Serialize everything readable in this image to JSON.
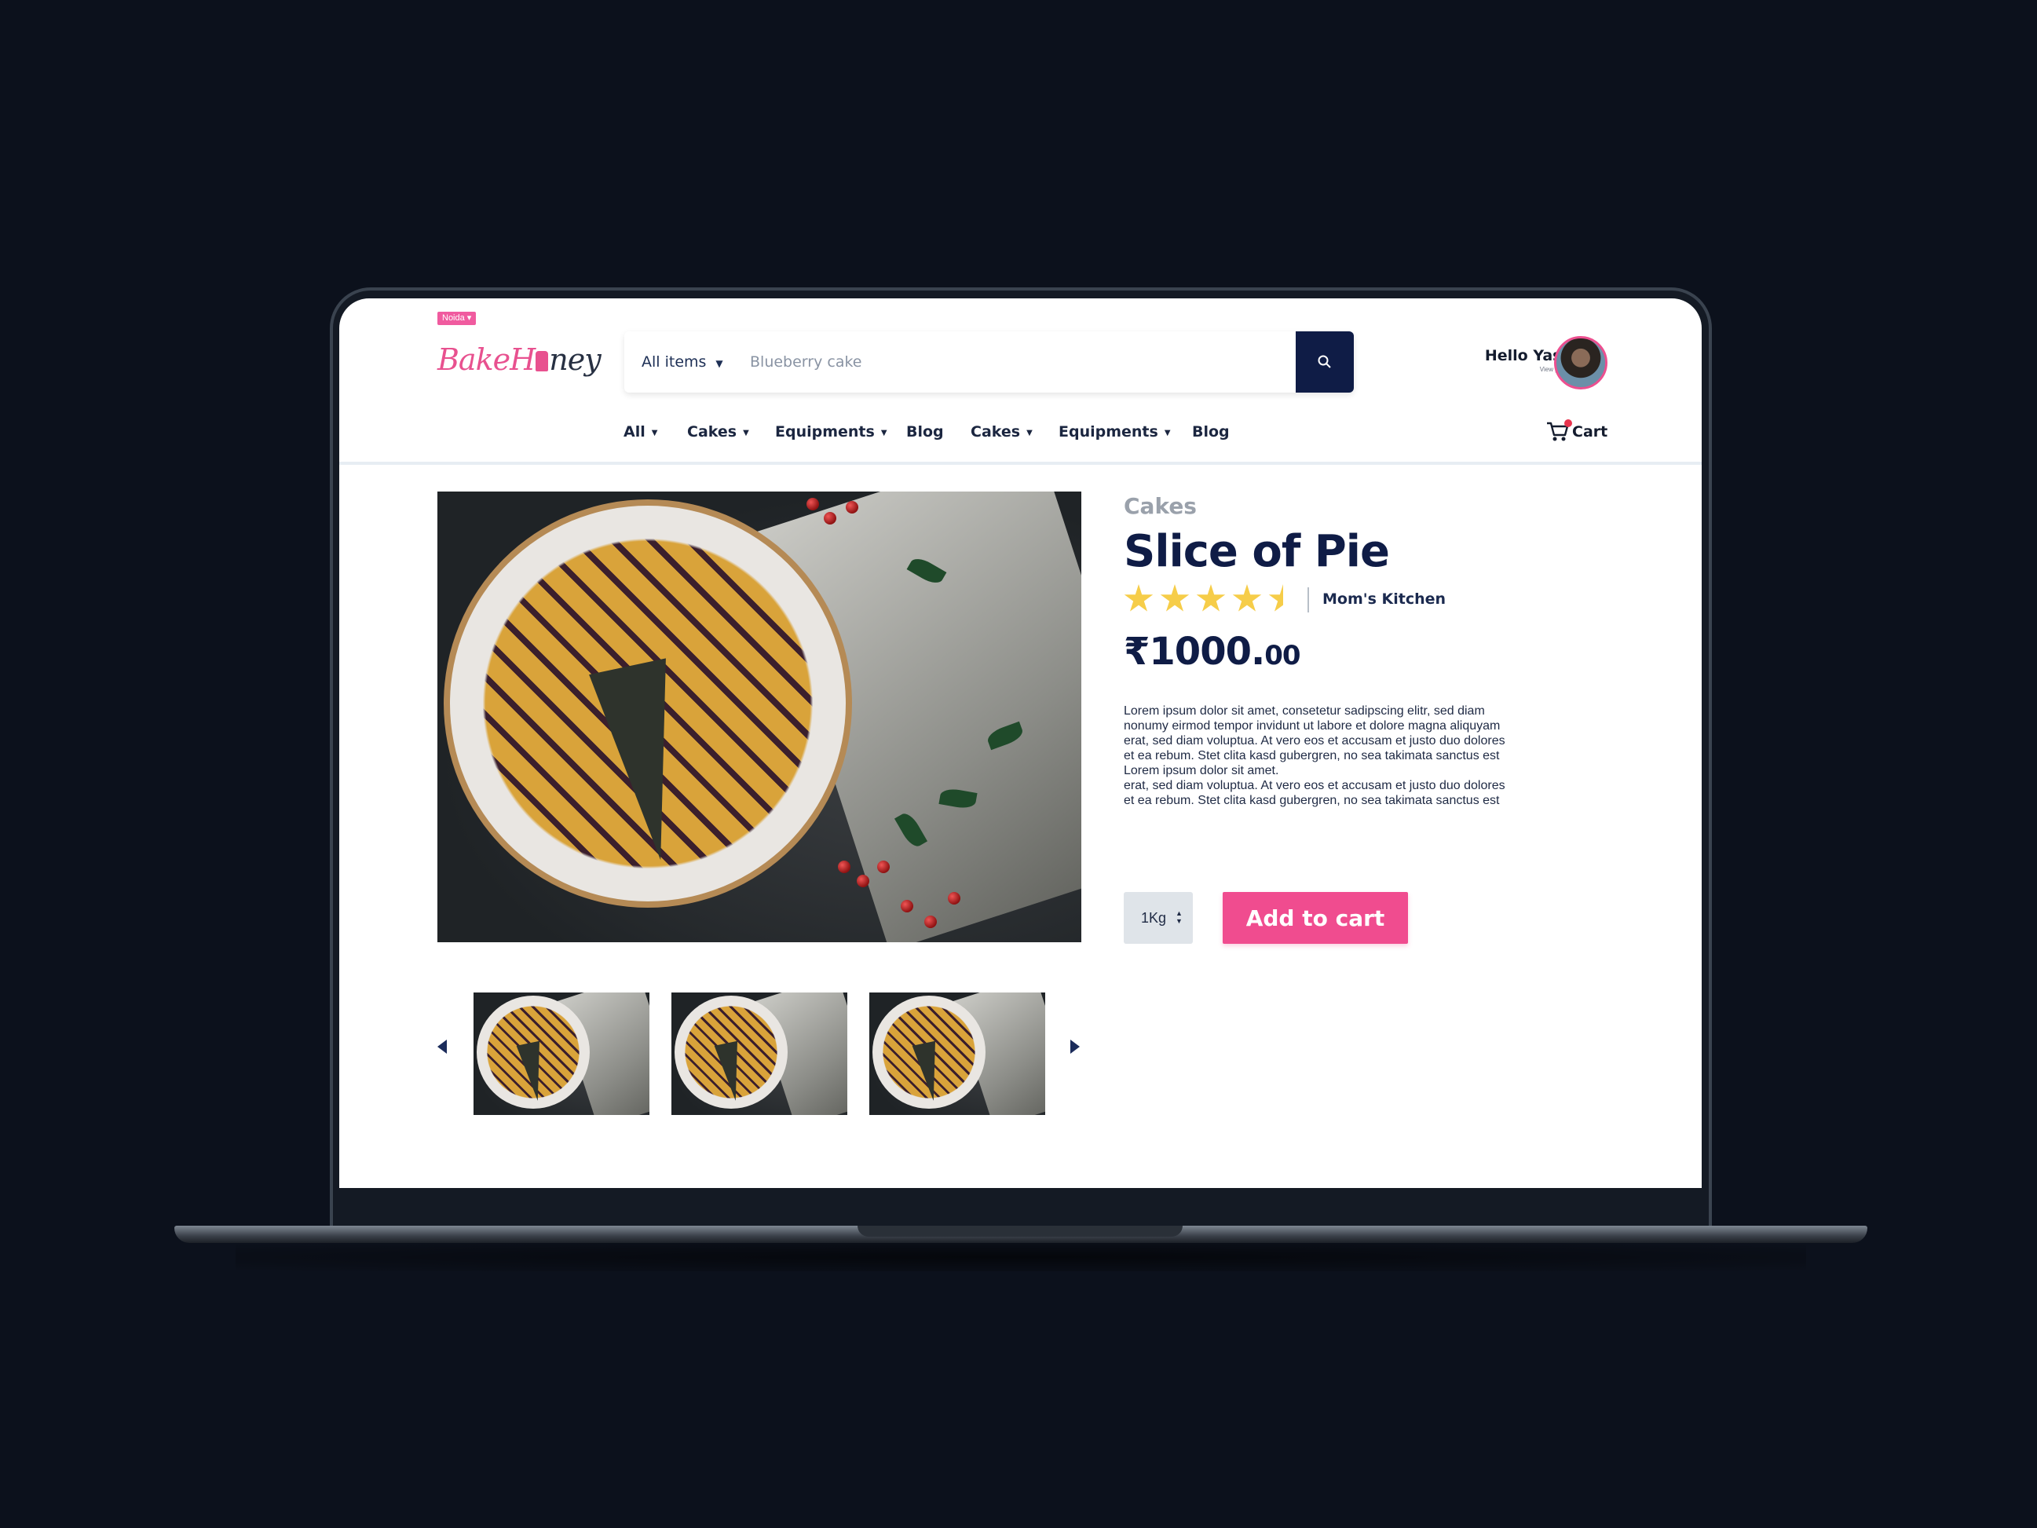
{
  "header": {
    "location_badge": "Noida ▾",
    "logo": {
      "part1": "Bake",
      "part2": "H",
      "part3": "ney"
    },
    "search": {
      "category_label": "All items",
      "placeholder": "Blueberry cake"
    },
    "user": {
      "greeting": "Hello Yash",
      "view_profile": "View profile"
    },
    "cart_label": "Cart"
  },
  "nav": {
    "items": [
      {
        "label": "All",
        "has_dropdown": true
      },
      {
        "label": "Cakes",
        "has_dropdown": true
      },
      {
        "label": "Equipments",
        "has_dropdown": true
      },
      {
        "label": "Blog",
        "has_dropdown": false
      },
      {
        "label": "Cakes",
        "has_dropdown": true
      },
      {
        "label": "Equipments",
        "has_dropdown": true
      },
      {
        "label": "Blog",
        "has_dropdown": false
      }
    ]
  },
  "product": {
    "category": "Cakes",
    "title": "Slice of Pie",
    "rating": 4.5,
    "rating_max": 5,
    "seller": "Mom's Kitchen",
    "price_main": "₹1000.",
    "price_cents": "00",
    "description": "Lorem ipsum dolor sit amet, consetetur sadipscing elitr, sed diam\nnonumy eirmod tempor invidunt ut labore et dolore magna aliquyam\nerat, sed diam voluptua. At vero eos et accusam et justo duo dolores\net ea rebum. Stet clita kasd gubergren, no sea takimata sanctus est\nLorem ipsum dolor sit amet.\nerat, sed diam voluptua. At vero eos et accusam et justo duo dolores\net ea rebum. Stet clita kasd gubergren, no sea takimata sanctus est",
    "quantity": "1Kg",
    "add_to_cart_label": "Add to cart"
  },
  "gallery": {
    "thumbnail_count": 3
  },
  "colors": {
    "brand_pink": "#f04c8f",
    "navy": "#0f1c46",
    "star": "#f6cd49"
  }
}
